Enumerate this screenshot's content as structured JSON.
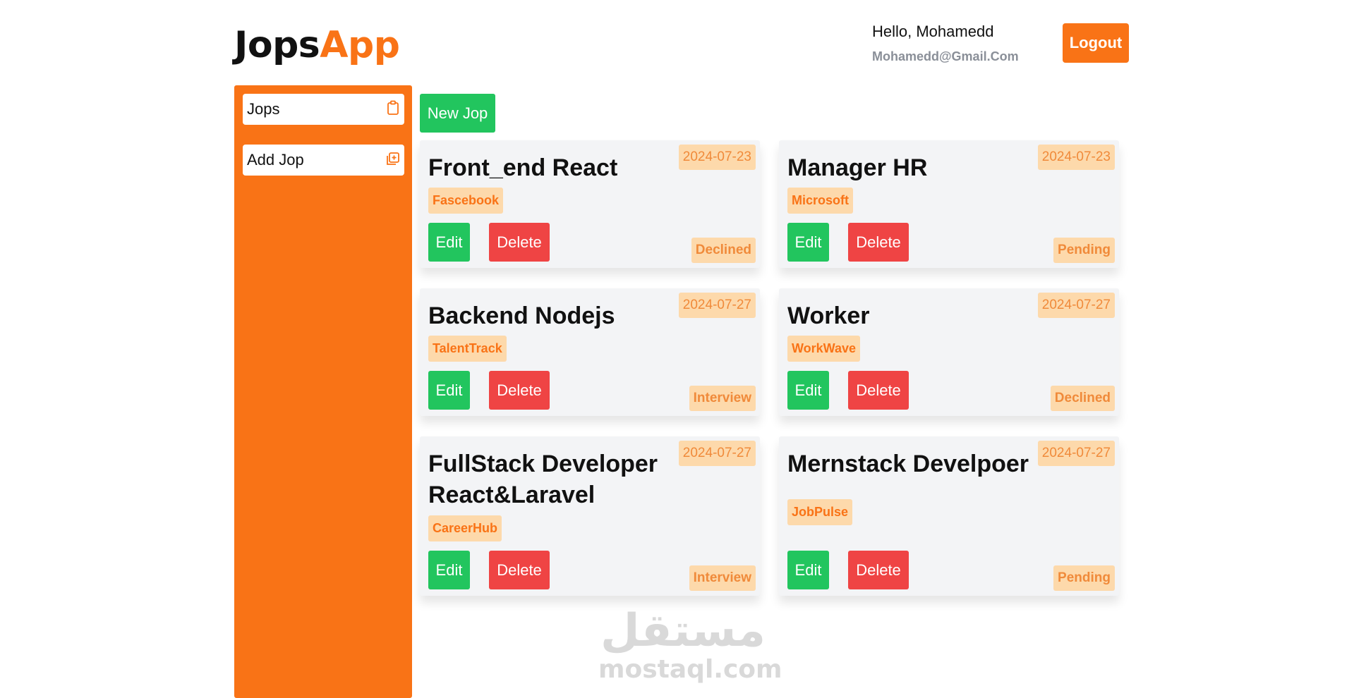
{
  "header": {
    "logo_part1": "Jops",
    "logo_part2": "App",
    "greeting": "Hello, Mohamedd",
    "email": "Mohamedd@Gmail.Com",
    "logout_label": "Logout"
  },
  "sidebar": {
    "items": [
      {
        "label": "Jops",
        "icon": "clipboard-icon"
      },
      {
        "label": "Add Jop",
        "icon": "add-square-icon"
      }
    ]
  },
  "main": {
    "new_label": "New Jop",
    "edit_label": "Edit",
    "delete_label": "Delete",
    "jobs": [
      {
        "title": "Front_end React",
        "date": "2024-07-23",
        "company": "Fascebook",
        "status": "Declined"
      },
      {
        "title": "Manager HR",
        "date": "2024-07-23",
        "company": "Microsoft",
        "status": "Pending"
      },
      {
        "title": "Backend Nodejs",
        "date": "2024-07-27",
        "company": "TalentTrack",
        "status": "Interview"
      },
      {
        "title": "Worker",
        "date": "2024-07-27",
        "company": "WorkWave",
        "status": "Declined"
      },
      {
        "title": "FullStack Developer React&Laravel",
        "date": "2024-07-27",
        "company": "CareerHub",
        "status": "Interview"
      },
      {
        "title": "Mernstack Develpoer",
        "date": "2024-07-27",
        "company": "JobPulse",
        "status": "Pending"
      }
    ]
  },
  "watermark": {
    "arabic": "مستقل",
    "latin": "mostaql.com"
  },
  "colors": {
    "accent": "#f97316",
    "success": "#22c55e",
    "danger": "#ef4444",
    "badge_bg": "#fdd9ab",
    "card_bg": "#f3f4f6"
  }
}
